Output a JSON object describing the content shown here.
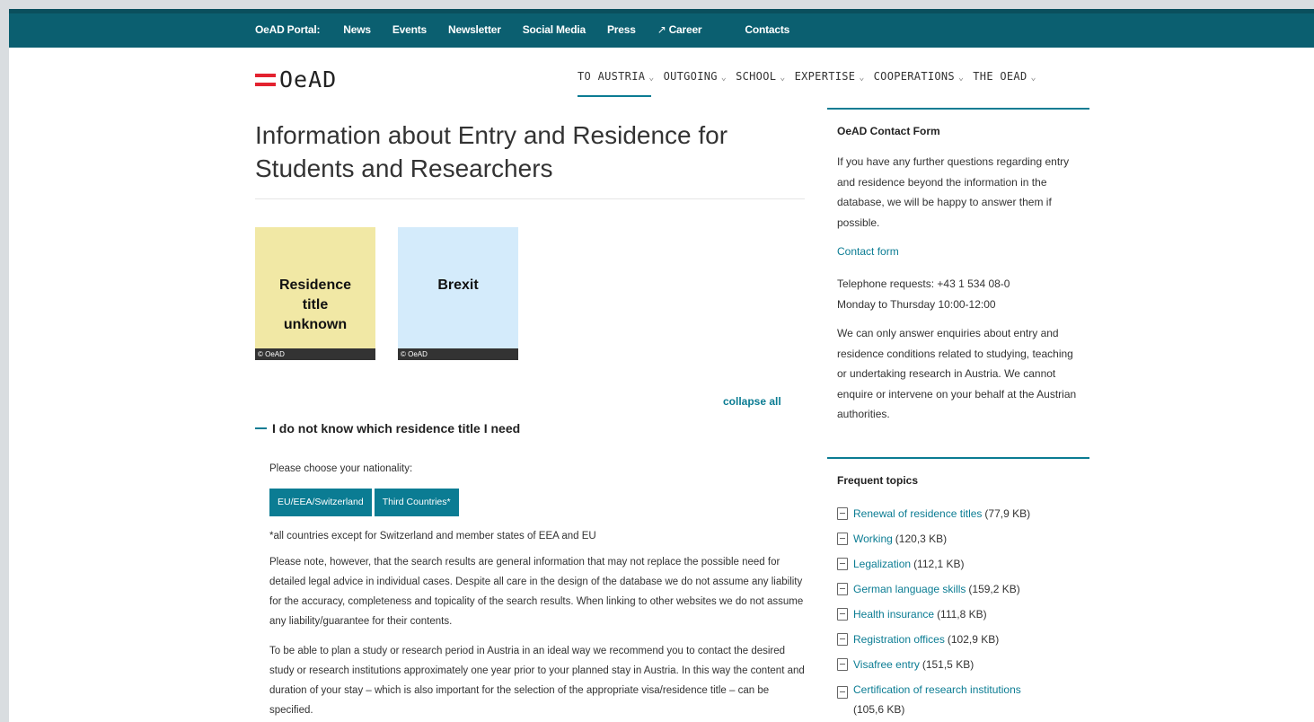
{
  "topbar": {
    "portal_label": "OeAD Portal:",
    "links": [
      "News",
      "Events",
      "Newsletter",
      "Social Media",
      "Press",
      "Career",
      "Contacts"
    ]
  },
  "logo": {
    "text": "OeAD"
  },
  "mainnav": [
    {
      "label": "TO AUSTRIA",
      "active": true
    },
    {
      "label": "OUTGOING"
    },
    {
      "label": "SCHOOL"
    },
    {
      "label": "EXPERTISE"
    },
    {
      "label": "COOPERATIONS"
    },
    {
      "label": "THE OEAD"
    }
  ],
  "main": {
    "title": "Information about Entry and Residence for Students and Researchers",
    "tiles": [
      {
        "label": "Residence title unknown",
        "credit": "© OeAD",
        "color": "#f1e8a5"
      },
      {
        "label": "Brexit",
        "credit": "© OeAD",
        "color": "#d4ebfb"
      }
    ],
    "collapse_all": "collapse all",
    "accordion_title": "I do not know which residence title I need",
    "choose_nationality": "Please choose your nationality:",
    "buttons": [
      "EU/EEA/Switzerland",
      "Third Countries*"
    ],
    "note": "*all countries except for Switzerland and member states of EEA and EU",
    "disclaimer": "Please note, however, that the search results are general information that may not replace the possible need for detailed legal advice in individual cases. Despite all care in the design of the database we do not assume any liability for the accuracy, completeness and topicality of the search results. When linking to other websites we do not assume any liability/guarantee for their contents.",
    "plan": "To be able to plan a study or research period in Austria in an ideal way we recommend you to contact the desired study or research institutions approximately one year prior to your planned stay in Austria. In this way the content and duration of your stay – which is also important for the selection of the appropriate visa/residence title – can be specified."
  },
  "sidebar": {
    "contact_heading": "OeAD Contact Form",
    "contact_text": "If you have any further questions regarding entry and residence beyond the information in the database, we will be happy to answer them if possible.",
    "contact_link": "Contact form",
    "telephone": "Telephone requests: +43 1 534 08-0",
    "hours": "Monday to Thursday 10:00-12:00",
    "enquiries": "We can only answer enquiries about entry and residence conditions related to studying, teaching or undertaking research in Austria. We cannot enquire or intervene on your behalf at the Austrian authorities.",
    "topics_heading": "Frequent topics",
    "topics": [
      {
        "label": "Renewal of residence titles",
        "size": "(77,9 KB)"
      },
      {
        "label": "Working",
        "size": "(120,3 KB)"
      },
      {
        "label": "Legalization",
        "size": "(112,1 KB)"
      },
      {
        "label": "German language skills",
        "size": "(159,2 KB)"
      },
      {
        "label": "Health insurance",
        "size": "(111,8 KB)"
      },
      {
        "label": "Registration offices",
        "size": "(102,9 KB)"
      },
      {
        "label": "Visafree entry",
        "size": "(151,5 KB)"
      },
      {
        "label": "Certification of research institutions",
        "size": "(105,6 KB)"
      }
    ]
  },
  "colors": {
    "teal": "#0b5f70",
    "accent": "#0b7c93",
    "flag_red": "#e3222f"
  }
}
